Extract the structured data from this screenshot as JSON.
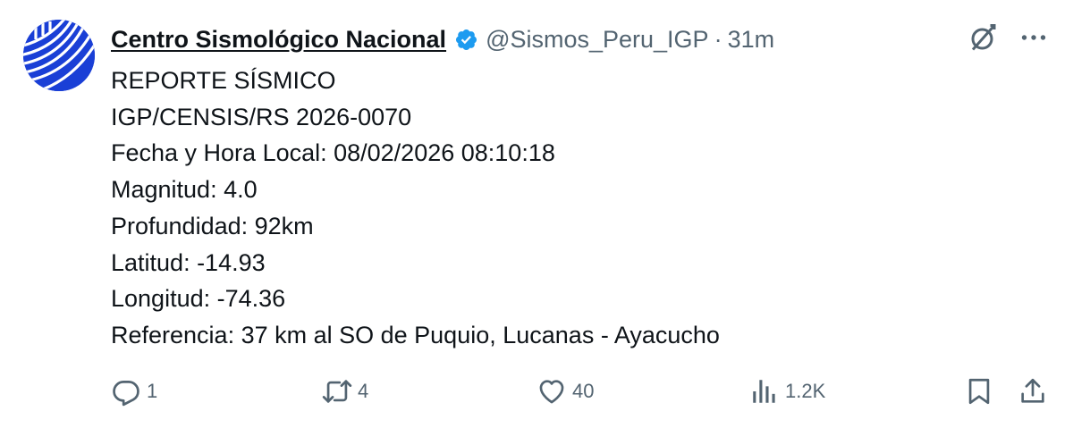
{
  "account": {
    "display_name": "Centro Sismológico Nacional",
    "handle": "@Sismos_Peru_IGP",
    "separator": "·",
    "timestamp": "31m"
  },
  "tweet": {
    "lines": [
      "REPORTE SÍSMICO",
      "IGP/CENSIS/RS 2026-0070",
      "Fecha y Hora Local: 08/02/2026 08:10:18",
      "Magnitud: 4.0",
      "Profundidad: 92km",
      "Latitud: -14.93",
      "Longitud: -74.36",
      "Referencia: 37 km al SO de Puquio, Lucanas - Ayacucho"
    ]
  },
  "actions": {
    "replies": "1",
    "reposts": "4",
    "likes": "40",
    "views": "1.2K"
  },
  "icons": {
    "verified": "verified-badge-icon",
    "grok": "grok-icon",
    "more": "more-icon",
    "reply": "reply-icon",
    "repost": "repost-icon",
    "like": "like-icon",
    "views": "views-icon",
    "bookmark": "bookmark-icon",
    "share": "share-icon"
  },
  "colors": {
    "text": "#0f1419",
    "secondary": "#536471",
    "verified": "#1d9bf0",
    "avatar": "#1a3fd6"
  }
}
